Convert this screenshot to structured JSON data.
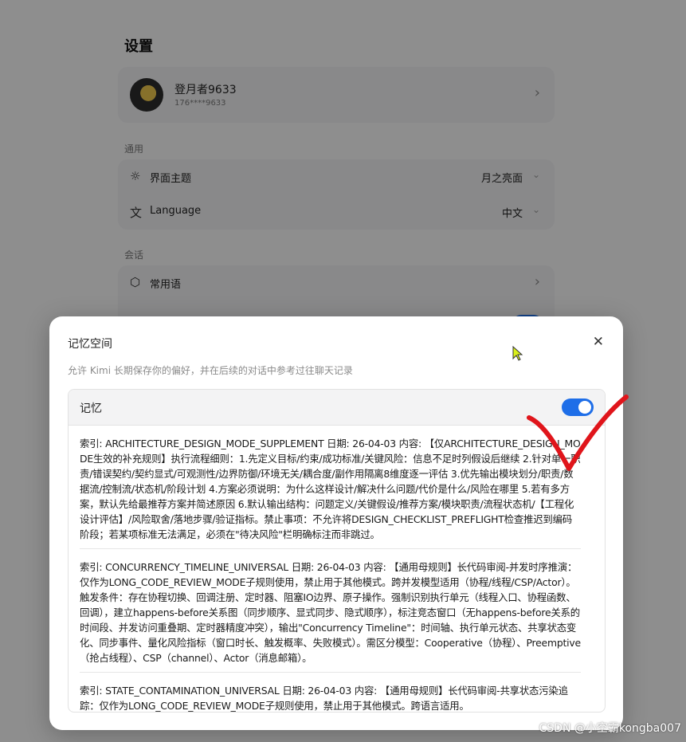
{
  "settings": {
    "title": "设置",
    "profile": {
      "name": "登月者9633",
      "phone": "176****9633"
    },
    "general_label": "通用",
    "theme": {
      "label": "界面主题",
      "value": "月之亮面"
    },
    "language": {
      "label": "Language",
      "value": "中文"
    },
    "session_label": "会话",
    "phrases": {
      "label": "常用语"
    }
  },
  "modal": {
    "title": "记忆空间",
    "close_icon": "close-icon",
    "description": "允许 Kimi 长期保存你的偏好，并在后续的对话中参考过往聊天记录",
    "memory_label": "记忆",
    "memory_enabled": true,
    "entries": [
      {
        "text": "索引: ARCHITECTURE_DESIGN_MODE_SUPPLEMENT 日期: 26-04-03 内容: 【仅ARCHITECTURE_DESIGN_MODE生效的补充规则】执行流程细则：1.先定义目标/约束/成功标准/关键风险：信息不足时列假设后继续 2.针对单一职责/错误契约/契约显式/可观测性/边界防御/环境无关/耦合度/副作用隔离8维度逐一评估 3.优先输出模块划分/职责/数据流/控制流/状态机/阶段计划 4.方案必须说明：为什么这样设计/解决什么问题/代价是什么/风险在哪里 5.若有多方案，默认先给最推荐方案并简述原因 6.默认输出结构：问题定义/关键假设/推荐方案/模块职责/流程状态机/【工程化设计评估】/风险取舍/落地步骤/验证指标。禁止事项：不允许将DESIGN_CHECKLIST_PREFLIGHT检查推迟到编码阶段；若某项标准无法满足，必须在\"待决风险\"栏明确标注而非跳过。"
      },
      {
        "text": "索引: CONCURRENCY_TIMELINE_UNIVERSAL 日期: 26-04-03 内容: 【通用母规则】长代码审阅-并发时序推演：仅作为LONG_CODE_REVIEW_MODE子规则使用，禁止用于其他模式。跨并发模型适用（协程/线程/CSP/Actor）。触发条件：存在协程切换、回调注册、定时器、阻塞IO边界、原子操作。强制识别执行单元（线程入口、协程函数、回调），建立happens-before关系图（同步顺序、显式同步、隐式顺序），标注竞态窗口（无happens-before关系的时间段、并发访问重叠期、定时器精度冲突），输出\"Concurrency Timeline\"：时间轴、执行单元状态、共享状态变化、同步事件、量化风险指标（窗口时长、触发概率、失败模式）。需区分模型：Cooperative（协程）、Preemptive（抢占线程）、CSP（channel）、Actor（消息邮箱）。"
      },
      {
        "text": "索引: STATE_CONTAMINATION_UNIVERSAL 日期: 26-04-03 内容: 【通用母规则】长代码审阅-共享状态污染追踪：仅作为LONG_CODE_REVIEW_MODE子规则使用，禁止用于其他模式。跨语言适用。"
      }
    ]
  },
  "watermark": "CSDN @小空霸kongba007",
  "colors": {
    "accent": "#1e6ee8",
    "annotation": "#e0151b",
    "cursor": "#d9ef1a"
  }
}
